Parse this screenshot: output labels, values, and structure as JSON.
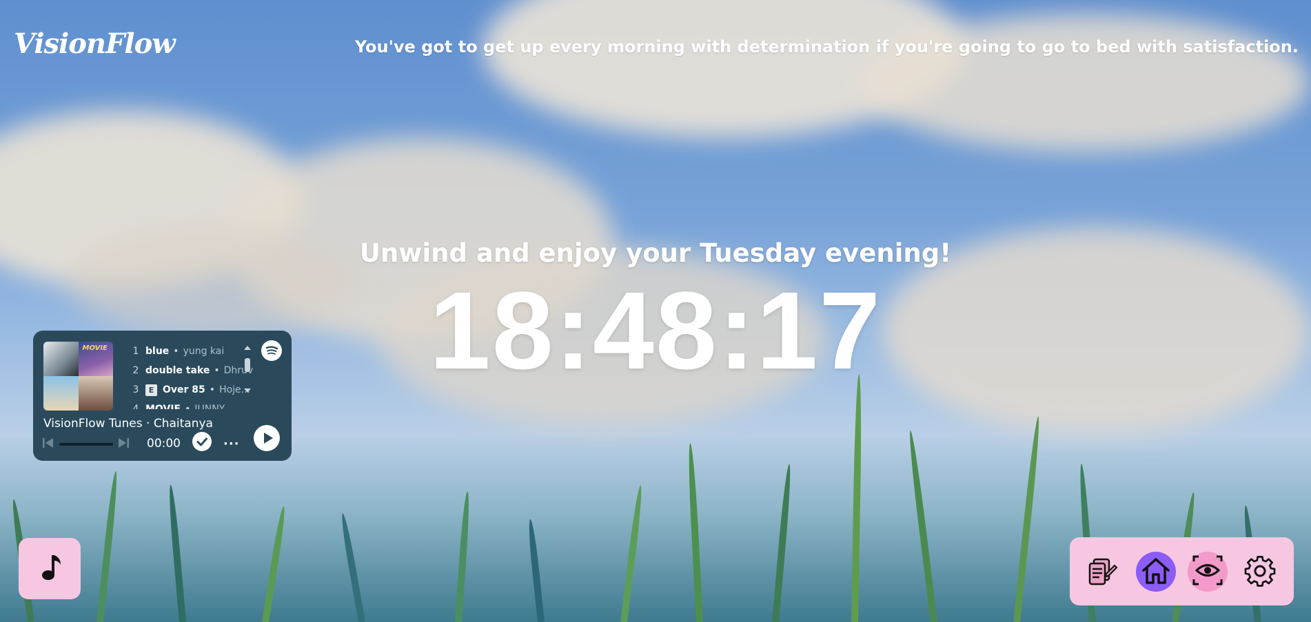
{
  "app": {
    "logo": "VisionFlow"
  },
  "quote": "You've got to get up every morning with determination if you're going to go to bed with satisfaction.",
  "greeting": "Unwind and enjoy your Tuesday evening!",
  "clock": {
    "time": "18:48:17"
  },
  "player": {
    "tracks": [
      {
        "num": "1",
        "title": "blue",
        "artist": "yung kai",
        "explicit": false
      },
      {
        "num": "2",
        "title": "double take",
        "artist": "Dhruv",
        "explicit": false
      },
      {
        "num": "3",
        "title": "Over 85",
        "artist": "Hoje...",
        "explicit": true,
        "explicit_label": "E"
      },
      {
        "num": "4",
        "title": "MOVIE",
        "artist": "JUNNY",
        "explicit": false
      }
    ],
    "cover_art_label": "MOVIE",
    "playlist_title": "VisionFlow Tunes · Chaitanya",
    "time": "00:00",
    "more_label": "···",
    "progress": 0
  },
  "colors": {
    "accent_pink": "#f7c7e1",
    "player_bg": "#2a4a5c",
    "home_active": "#8b5cf6",
    "eye_bg": "#f29ac9"
  },
  "icons": {
    "music": "music-note-icon",
    "notes": "notes-icon",
    "home": "home-icon",
    "focus": "eye-icon",
    "settings": "gear-icon",
    "spotify": "spotify-icon"
  }
}
